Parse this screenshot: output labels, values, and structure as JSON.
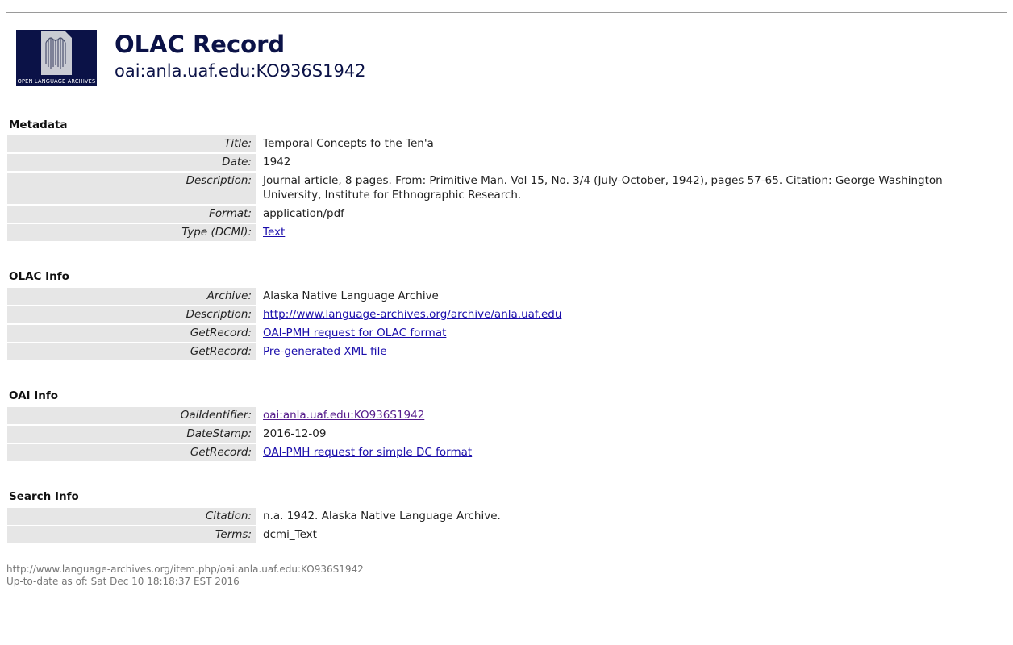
{
  "header": {
    "logo_caption": "OPEN LANGUAGE ARCHIVES",
    "title": "OLAC Record",
    "identifier": "oai:anla.uaf.edu:KO936S1942"
  },
  "metadata": {
    "heading": "Metadata",
    "rows": [
      {
        "label": "Title:",
        "value": "Temporal Concepts fo the Ten'a"
      },
      {
        "label": "Date:",
        "value": "1942"
      },
      {
        "label": "Description:",
        "value": "Journal article, 8 pages. From: Primitive Man. Vol 15, No. 3/4 (July-October, 1942), pages 57-65. Citation: George Washington University, Institute for Ethnographic Research."
      },
      {
        "label": "Format:",
        "value": "application/pdf"
      },
      {
        "label": "Type (DCMI):",
        "value": "Text"
      }
    ]
  },
  "olac_info": {
    "heading": "OLAC Info",
    "rows": [
      {
        "label": "Archive:",
        "value": "Alaska Native Language Archive"
      },
      {
        "label": "Description:",
        "value": "http://www.language-archives.org/archive/anla.uaf.edu"
      },
      {
        "label": "GetRecord:",
        "value": "OAI-PMH request for OLAC format"
      },
      {
        "label": "GetRecord:",
        "value": "Pre-generated XML file"
      }
    ]
  },
  "oai_info": {
    "heading": "OAI Info",
    "rows": [
      {
        "label": "OaiIdentifier:",
        "value": "oai:anla.uaf.edu:KO936S1942"
      },
      {
        "label": "DateStamp:",
        "value": "2016-12-09"
      },
      {
        "label": "GetRecord:",
        "value": "OAI-PMH request for simple DC format"
      }
    ]
  },
  "search_info": {
    "heading": "Search Info",
    "rows": [
      {
        "label": "Citation:",
        "value": "n.a. 1942. Alaska Native Language Archive."
      },
      {
        "label": "Terms:",
        "value": "dcmi_Text"
      }
    ]
  },
  "footer": {
    "url": "http://www.language-archives.org/item.php/oai:anla.uaf.edu:KO936S1942",
    "updated": "Up-to-date as of: Sat Dec 10 18:18:37 EST 2016"
  },
  "colors": {
    "brand_navy": "#0b1247",
    "link": "#1a0dab",
    "visited_link": "#551a8b",
    "label_background": "#e6e6e6"
  }
}
